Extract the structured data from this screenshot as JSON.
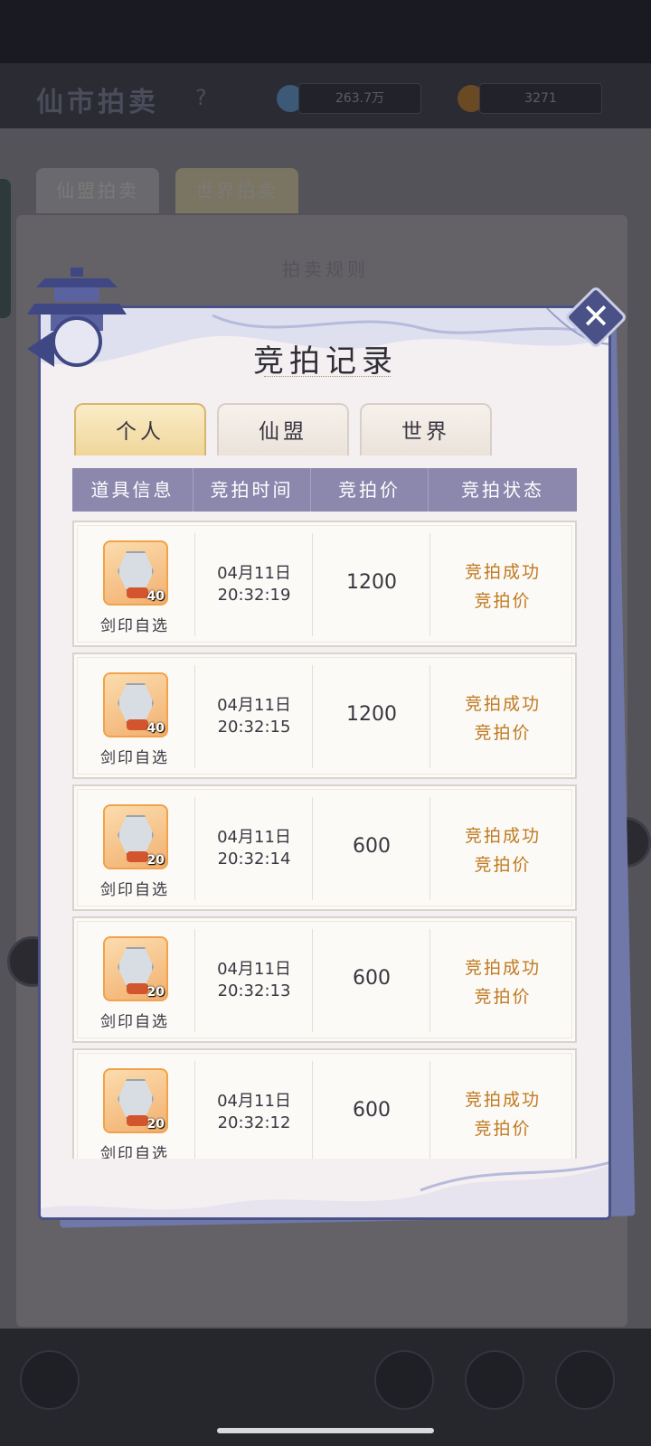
{
  "background": {
    "title": "仙市拍卖",
    "help": "?",
    "resource_1": "263.7万",
    "resource_2": "3271",
    "tabs": [
      "仙盟拍卖",
      "世界拍卖"
    ],
    "panel_title": "拍卖规则"
  },
  "modal": {
    "title": "竞拍记录",
    "close_icon": "close-icon",
    "tabs": [
      {
        "label": "个人",
        "active": true
      },
      {
        "label": "仙盟",
        "active": false
      },
      {
        "label": "世界",
        "active": false
      }
    ],
    "columns": [
      "道具信息",
      "竞拍时间",
      "竞拍价",
      "竞拍状态"
    ],
    "rows": [
      {
        "item_name": "剑印自选",
        "qty": "40",
        "date": "04月11日",
        "time": "20:32:19",
        "price": "1200",
        "status_1": "竞拍成功",
        "status_2": "竞拍价"
      },
      {
        "item_name": "剑印自选",
        "qty": "40",
        "date": "04月11日",
        "time": "20:32:15",
        "price": "1200",
        "status_1": "竞拍成功",
        "status_2": "竞拍价"
      },
      {
        "item_name": "剑印自选",
        "qty": "20",
        "date": "04月11日",
        "time": "20:32:14",
        "price": "600",
        "status_1": "竞拍成功",
        "status_2": "竞拍价"
      },
      {
        "item_name": "剑印自选",
        "qty": "20",
        "date": "04月11日",
        "time": "20:32:13",
        "price": "600",
        "status_1": "竞拍成功",
        "status_2": "竞拍价"
      },
      {
        "item_name": "剑印自选",
        "qty": "20",
        "date": "04月11日",
        "time": "20:32:12",
        "price": "600",
        "status_1": "竞拍成功",
        "status_2": "竞拍价"
      }
    ]
  },
  "colors": {
    "accent_status": "#c07a1f",
    "header_bg": "#8c87ad",
    "modal_border": "#4a5186",
    "tab_active": "#efd69b"
  }
}
